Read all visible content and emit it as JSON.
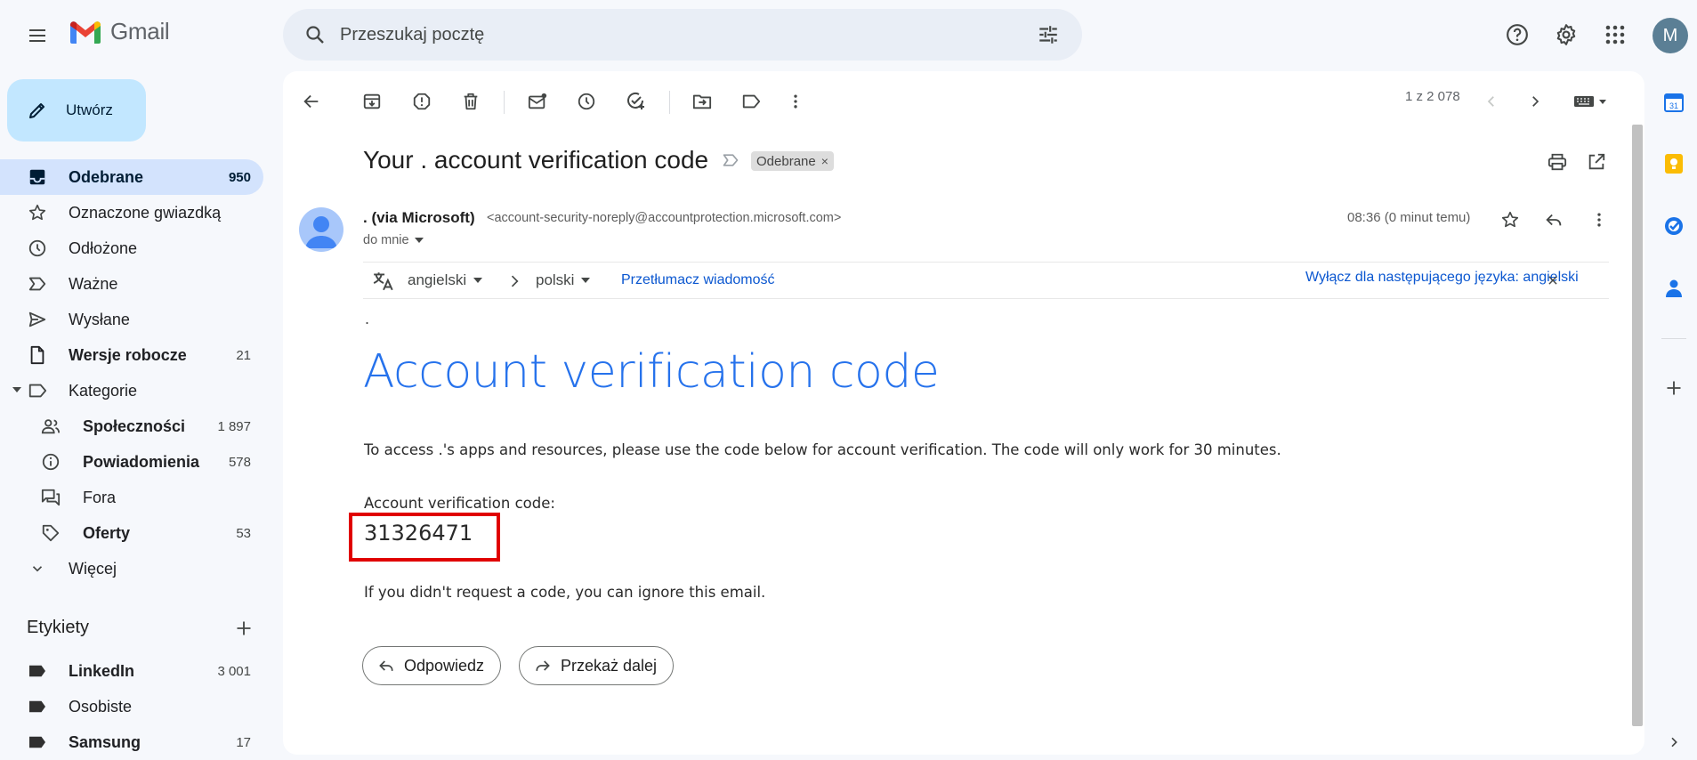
{
  "app": {
    "name": "Gmail"
  },
  "search": {
    "placeholder": "Przeszukaj pocztę"
  },
  "user": {
    "avatar_letter": "M",
    "avatar_color": "#5b7f95"
  },
  "compose": {
    "label": "Utwórz"
  },
  "sidebar": {
    "items": [
      {
        "label": "Odebrane",
        "count": "950",
        "icon": "inbox-icon"
      },
      {
        "label": "Oznaczone gwiazdką",
        "count": "",
        "icon": "star-icon"
      },
      {
        "label": "Odłożone",
        "count": "",
        "icon": "clock-icon"
      },
      {
        "label": "Ważne",
        "count": "",
        "icon": "important-icon"
      },
      {
        "label": "Wysłane",
        "count": "",
        "icon": "send-icon"
      },
      {
        "label": "Wersje robocze",
        "count": "21",
        "icon": "draft-icon"
      },
      {
        "label": "Kategorie",
        "count": "",
        "icon": "label-icon"
      },
      {
        "label": "Społeczności",
        "count": "1 897",
        "icon": "people-icon"
      },
      {
        "label": "Powiadomienia",
        "count": "578",
        "icon": "info-icon"
      },
      {
        "label": "Fora",
        "count": "",
        "icon": "forum-icon"
      },
      {
        "label": "Oferty",
        "count": "53",
        "icon": "tag-icon"
      },
      {
        "label": "Więcej",
        "count": "",
        "icon": "chevron-down-icon"
      }
    ],
    "labels_title": "Etykiety",
    "labels": [
      {
        "label": "LinkedIn",
        "count": "3 001"
      },
      {
        "label": "Osobiste",
        "count": ""
      },
      {
        "label": "Samsung",
        "count": "17"
      }
    ]
  },
  "toolbar": {
    "pager": "1 z 2 078"
  },
  "email": {
    "subject": "Your . account verification code",
    "label_chip": "Odebrane",
    "label_chip_close": "×",
    "sender_name": ". (via Microsoft)",
    "sender_email": "<account-security-noreply@accountprotection.microsoft.com>",
    "to": "do mnie",
    "time": "08:36 (0 minut temu)",
    "translate": {
      "from_lang": "angielski",
      "to_lang": "polski",
      "translate_link": "Przetłumacz wiadomość",
      "disable_link": "Wyłącz dla następującego języka: angielski"
    },
    "body": {
      "dot": ".",
      "heading": "Account verification code",
      "intro": "To access .'s apps and resources, please use the code below for account verification. The code will only work for 30 minutes.",
      "code_label": "Account verification code:",
      "code": "31326471",
      "footer": "If you didn't request a code, you can ignore this email."
    },
    "reply_label": "Odpowiedz",
    "forward_label": "Przekaż dalej"
  },
  "colors": {
    "accent": "#0b57d0",
    "heading_blue": "#2672ec",
    "highlight_box": "#e00000",
    "active_nav": "#d3e3fd",
    "compose_bg": "#c2e7ff"
  }
}
